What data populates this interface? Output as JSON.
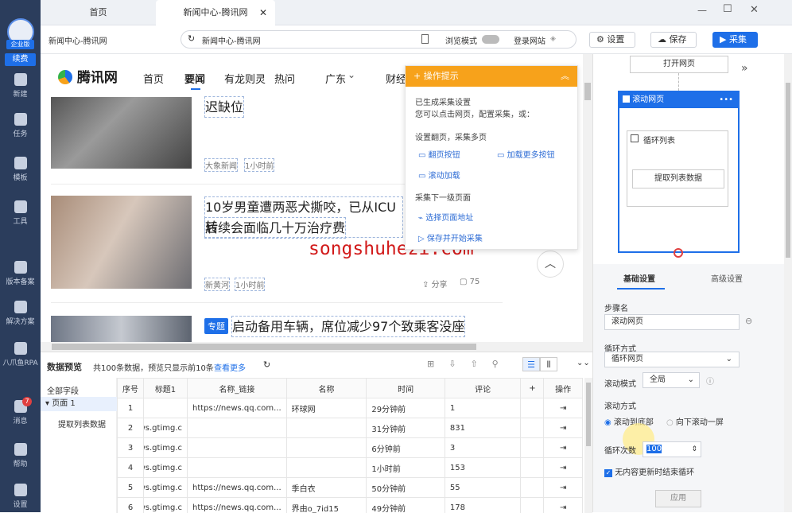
{
  "app": {
    "badge_label": "企业版",
    "tier": "续费"
  },
  "leftbar": [
    {
      "label": "新建",
      "icon": "plus-icon"
    },
    {
      "label": "任务",
      "icon": "flag-icon"
    },
    {
      "label": "模板",
      "icon": "template-icon"
    },
    {
      "label": "工具",
      "icon": "toolbox-icon"
    },
    {
      "label": "版本备案",
      "icon": "crown-icon"
    },
    {
      "label": "解决方案",
      "icon": "solution-icon"
    },
    {
      "label": "八爪鱼RPA",
      "icon": "robot-icon"
    },
    {
      "label": "消息",
      "icon": "bell-icon",
      "badge": "7"
    },
    {
      "label": "帮助",
      "icon": "help-icon"
    },
    {
      "label": "设置",
      "icon": "gear-icon"
    }
  ],
  "tabs": [
    {
      "label": "首页"
    },
    {
      "label": "新闻中心-腾讯网",
      "close": "✕"
    }
  ],
  "window": {
    "min": "—",
    "max": "☐",
    "close": "✕"
  },
  "address": {
    "page_title": "新闻中心-腾讯网",
    "url": "新闻中心-腾讯网",
    "browse_mode": "浏览模式",
    "login": "登录网站",
    "settings": "设置",
    "save": "保存",
    "collect": "采集"
  },
  "site": {
    "logo": "腾讯网",
    "nav": [
      "首页",
      "要闻",
      "有龙则灵",
      "热问",
      "广东",
      "财经"
    ],
    "nav_dropdown": "⌄",
    "news": [
      {
        "title": "迟缺位",
        "source": "大象新闻",
        "time": "1小时前"
      },
      {
        "title_line1": "10岁男童遭两恶犬撕咬，已从ICU转",
        "title_line2": "后续会面临几十万治疗费",
        "source": "新黄河",
        "time": "1小时前",
        "share": "分享",
        "comments": "75"
      },
      {
        "tag": "专题",
        "title": "启动备用车辆，席位减少97个致乘客没座"
      }
    ],
    "watermark": "songshuhezi.com"
  },
  "popup": {
    "header": "操作提示",
    "line1": "已生成采集设置",
    "line2": "您可以点击网页，配置采集，或：",
    "section1": "设置翻页，采集多页",
    "opt1": "翻页按钮",
    "opt2": "加载更多按钮",
    "opt3": "滚动加载",
    "section2": "采集下一级页面",
    "opt4": "选择页面地址",
    "opt5": "保存并开始采集"
  },
  "data_panel": {
    "title": "数据预览",
    "summary": "共100条数据，预览只显示前10条",
    "more": "查看更多",
    "all_fields": "全部字段",
    "page": "页面 1",
    "extract": "提取列表数据",
    "columns": [
      "序号",
      "标题1",
      "名称_链接",
      "名称",
      "时间",
      "评论",
      "+",
      "操作"
    ],
    "rows": [
      [
        "1",
        "",
        "https://news.qq.com...",
        "环球网",
        "29分钟前",
        "1"
      ],
      [
        "2",
        "https://news.gtimg.c...",
        "",
        "",
        "31分钟前",
        "831"
      ],
      [
        "3",
        "https://news.gtimg.c...",
        "",
        "",
        "6分钟前",
        "3"
      ],
      [
        "4",
        "https://news.gtimg.c...",
        "",
        "",
        "1小时前",
        "153"
      ],
      [
        "5",
        "https://news.gtimg.c...",
        "https://news.qq.com...",
        "季白衣",
        "50分钟前",
        "55"
      ],
      [
        "6",
        "https://news.gtimg.c...",
        "https://news.qq.com...",
        "界由o_7id15",
        "49分钟前",
        "178"
      ]
    ]
  },
  "flow": {
    "open": "打开网页",
    "scroll": "滚动网页",
    "loop": "循环列表",
    "extract": "提取列表数据",
    "more": "•••"
  },
  "settings": {
    "tab_basic": "基础设置",
    "tab_adv": "高级设置",
    "step_name_label": "步骤名",
    "step_name": "滚动网页",
    "loop_mode_label": "循环方式",
    "loop_mode": "循环网页",
    "scroll_mode_label": "滚动模式",
    "scroll_mode": "全局",
    "scroll_way_label": "滚动方式",
    "scroll_bottom": "滚动到底部",
    "scroll_screen": "向下滚动一屏",
    "loop_count_label": "循环次数",
    "loop_count": "100",
    "stop_label": "无内容更新时结束循环",
    "apply": "应用"
  },
  "colors": {
    "sidebar": "#2b3d5c",
    "accent": "#1e6fe8",
    "orange": "#f7a21b",
    "red": "#e04040"
  }
}
